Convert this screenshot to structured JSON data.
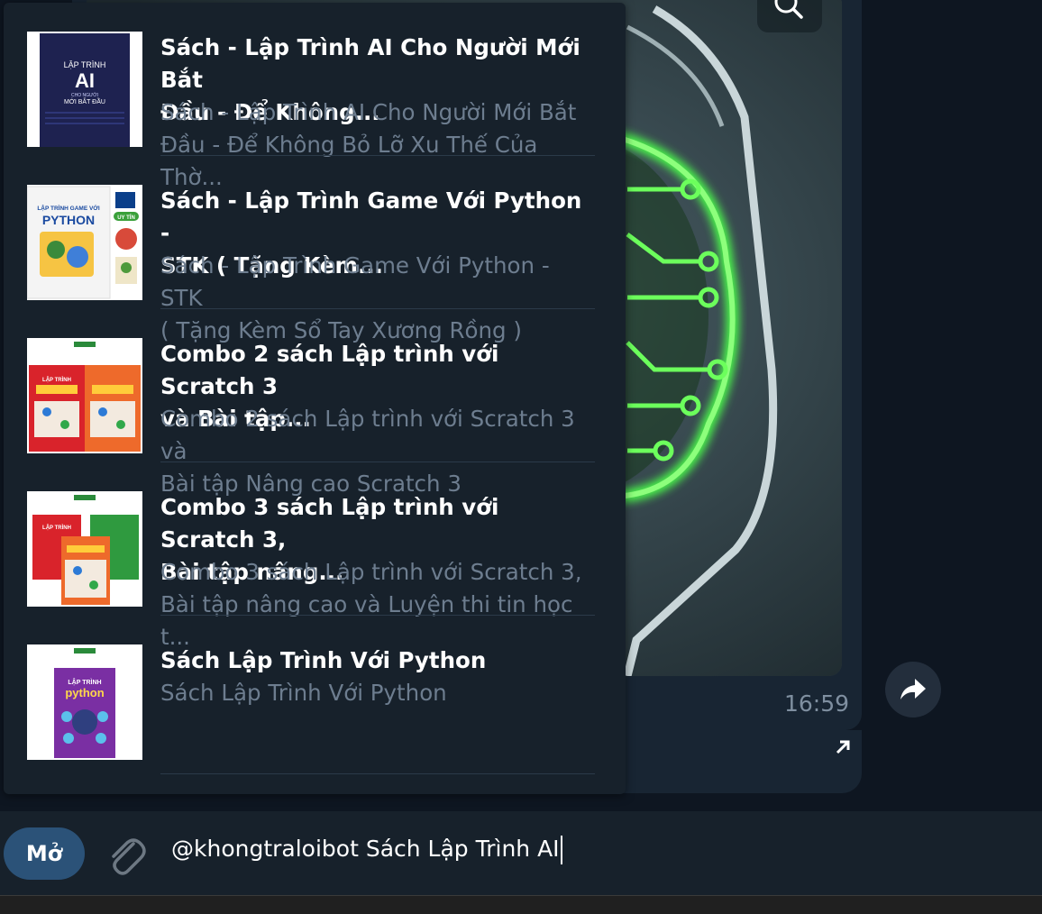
{
  "inline_results": [
    {
      "title": "Sách - Lập Trình AI Cho Người Mới Bắt\nĐầu - Để Không...",
      "description": "Sách - Lập Trình AI Cho Người Mới Bắt\nĐầu - Để Không Bỏ Lỡ Xu Thế Của Thờ...",
      "cover": {
        "line1": "LẬP TRÌNH",
        "line2": "AI",
        "line3": "CHO NGƯỜI",
        "line4": "MỚI BẮT ĐẦU"
      }
    },
    {
      "title": "Sách - Lập Trình Game Với Python -\nSTK ( Tặng Kèm...",
      "description": "Sách - Lập Trình Game Với Python - STK\n( Tặng Kèm Sổ Tay Xương Rồng )",
      "cover": {
        "line1": "LẬP TRÌNH GAME VỚI",
        "line2": "PYTHON",
        "badge": "UY TÍN"
      }
    },
    {
      "title": "Combo 2 sách Lập trình với Scratch 3\nvà Bài tập...",
      "description": "Combo 2 sách Lập trình với Scratch 3 và\nBài tập Nâng cao Scratch 3",
      "cover": {
        "line1": "LẬP TRÌNH"
      }
    },
    {
      "title": "Combo 3 sách Lập trình với Scratch 3,\nBài tập nâng...",
      "description": "Combo 3 sách Lập trình với Scratch 3,\nBài tập nâng cao và Luyện thi tin học t...",
      "cover": {
        "line1": "LẬP TRÌNH"
      }
    },
    {
      "title": "Sách Lập Trình Với Python",
      "description": "Sách Lập Trình Với Python",
      "cover": {
        "line1": "LẬP TRÌNH",
        "line2": "python"
      }
    }
  ],
  "message": {
    "time": "16:59"
  },
  "composer": {
    "open_button": "Mở",
    "input_text": "@khongtraloibot Sách Lập Trình AI"
  },
  "icons": {
    "zoom": "magnifier-icon",
    "forward": "forward-arrow-icon",
    "attach": "paperclip-icon",
    "expand": "diagonal-arrow-icon"
  },
  "colors": {
    "background": "#0e1621",
    "panel": "#17212b",
    "accent": "#2b5278",
    "title_text": "#ffffff",
    "desc_text": "#6d7d8f",
    "glow_green": "#4cff4c"
  }
}
